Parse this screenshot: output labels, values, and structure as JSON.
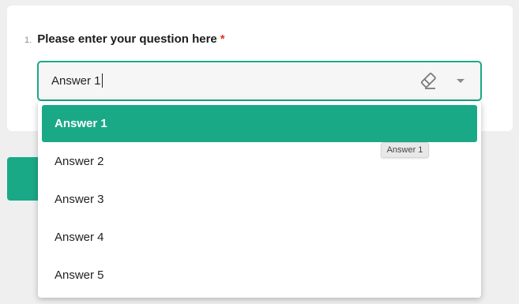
{
  "question": {
    "number": "1.",
    "text": "Please enter your question here",
    "required_marker": "*"
  },
  "combobox": {
    "value": "Answer 1",
    "clear_icon": "eraser-icon",
    "dropdown_icon": "triangle-down-icon"
  },
  "dropdown": {
    "selected_index": 0,
    "options": [
      {
        "label": "Answer 1"
      },
      {
        "label": "Answer 2"
      },
      {
        "label": "Answer 3"
      },
      {
        "label": "Answer 4"
      },
      {
        "label": "Answer 5"
      }
    ]
  },
  "tooltip": {
    "text": "Answer 1"
  },
  "colors": {
    "accent": "#1aa987",
    "required": "#e4322e",
    "background": "#efefef"
  }
}
